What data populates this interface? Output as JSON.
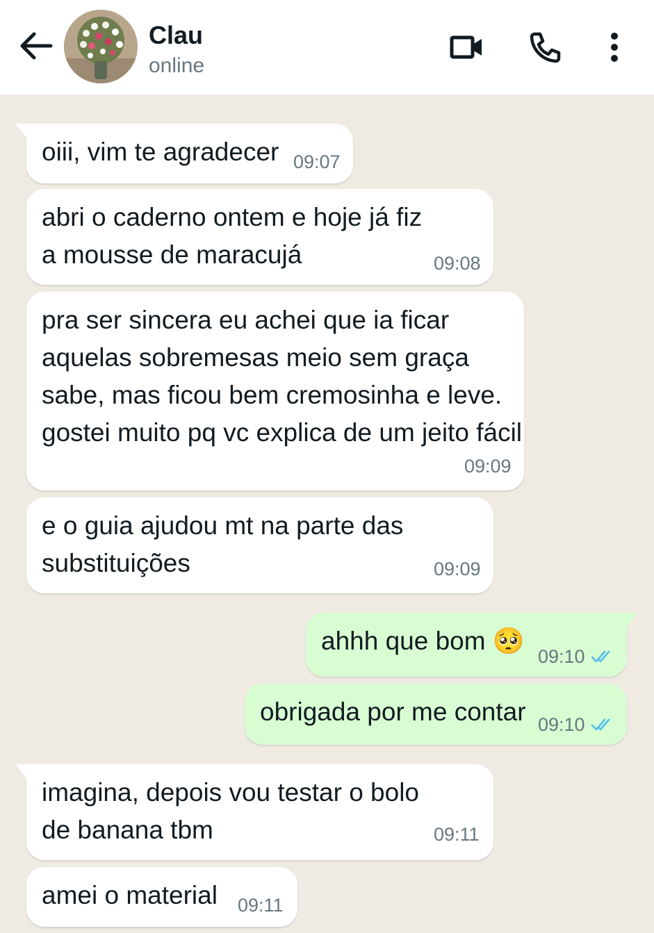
{
  "header": {
    "contact_name": "Clau",
    "status": "online",
    "icons": {
      "back": "arrow-left-icon",
      "video": "video-call-icon",
      "phone": "phone-call-icon",
      "menu": "more-vertical-icon"
    }
  },
  "colors": {
    "header_bg": "#ffffff",
    "chat_bg": "#efeae2",
    "incoming_bubble": "#ffffff",
    "outgoing_bubble": "#d9fdd3",
    "read_tick": "#53bdeb",
    "text": "#111b21",
    "meta_text": "#667781"
  },
  "messages": [
    {
      "direction": "incoming",
      "text": "oiii, vim te agradecer",
      "time": "09:07"
    },
    {
      "direction": "incoming",
      "text": "abri o caderno ontem e hoje já fiz\na mousse de maracujá",
      "time": "09:08"
    },
    {
      "direction": "incoming",
      "text": "pra ser sincera eu achei que ia ficar\naquelas sobremesas meio sem graça\nsabe, mas ficou bem cremosinha e leve.\ngostei muito pq vc explica de um jeito fácil",
      "time": "09:09"
    },
    {
      "direction": "incoming",
      "text": "e o guia ajudou mt na parte das\nsubstituições",
      "time": "09:09"
    },
    {
      "direction": "outgoing",
      "text": "ahhh que bom 🥺",
      "time": "09:10",
      "status": "read"
    },
    {
      "direction": "outgoing",
      "text": "obrigada por me contar",
      "time": "09:10",
      "status": "read"
    },
    {
      "direction": "incoming",
      "text": "imagina, depois vou testar o bolo\nde banana tbm",
      "time": "09:11"
    },
    {
      "direction": "incoming",
      "text": "amei o material",
      "time": "09:11"
    }
  ]
}
